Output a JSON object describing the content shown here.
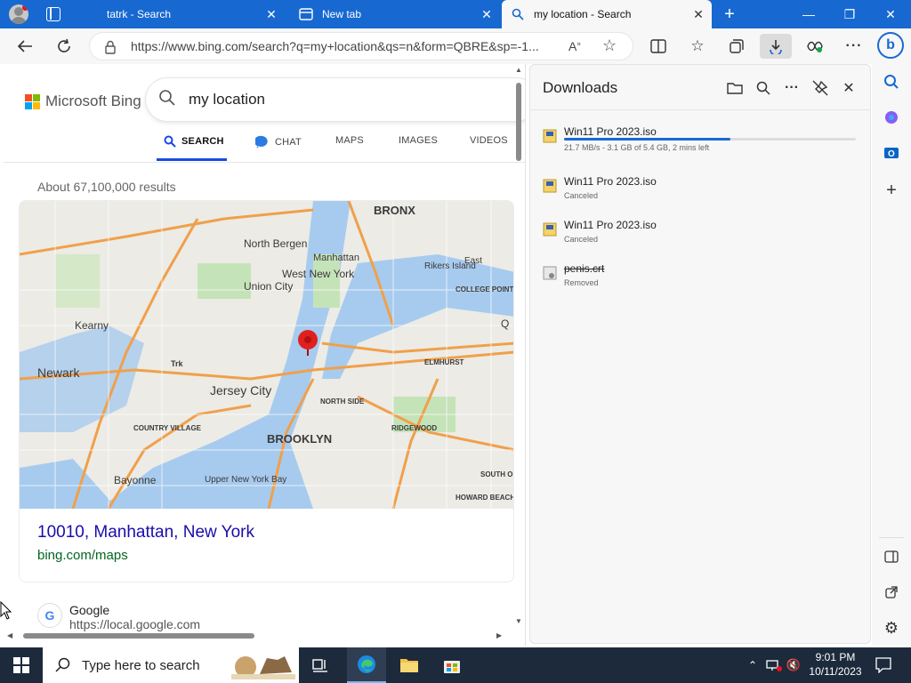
{
  "tabs": [
    {
      "title": "tatrk - Search",
      "active": false
    },
    {
      "title": "New tab",
      "active": false
    },
    {
      "title": "my location - Search",
      "active": true
    }
  ],
  "address_bar": {
    "url": "https://www.bing.com/search?q=my+location&qs=n&form=QBRE&sp=-1..."
  },
  "bing": {
    "logo_text": "Microsoft Bing",
    "query": "my location",
    "nav": [
      "SEARCH",
      "CHAT",
      "MAPS",
      "IMAGES",
      "VIDEOS"
    ],
    "results_count": "About 67,100,000 results",
    "map_result": {
      "title": "10010, Manhattan, New York",
      "url": "bing.com/maps"
    },
    "map_labels": [
      "BRONX",
      "North Bergen",
      "Manhattan",
      "West New York",
      "Union City",
      "Rikers Island",
      "East",
      "COLLEGE POINT",
      "Kearny",
      "Newark",
      "Trk",
      "Jersey City",
      "NORTH SIDE",
      "ELMHURST",
      "COUNTRY VILLAGE",
      "BROOKLYN",
      "RIDGEWOOD",
      "Bayonne",
      "Upper New York Bay",
      "SOUTH O",
      "HOWARD BEACH",
      "Q"
    ],
    "next_result": {
      "title": "Google",
      "url": "https://local.google.com"
    }
  },
  "downloads": {
    "title": "Downloads",
    "items": [
      {
        "name": "Win11 Pro 2023.iso",
        "status": "21.7 MB/s - 3.1 GB of 5.4 GB, 2 mins left",
        "progress": 0.57
      },
      {
        "name": "Win11 Pro 2023.iso",
        "status": "Canceled"
      },
      {
        "name": "Win11 Pro 2023.iso",
        "status": "Canceled"
      },
      {
        "name": "penis.crt",
        "status": "Removed"
      }
    ]
  },
  "taskbar": {
    "search_placeholder": "Type here to search",
    "time": "9:01 PM",
    "date": "10/11/2023"
  },
  "colors": {
    "titlebar": "#1769d1",
    "accent": "#174ae4",
    "taskbar": "#1c2a3c",
    "link": "#1a0dab",
    "url_green": "#006621"
  }
}
